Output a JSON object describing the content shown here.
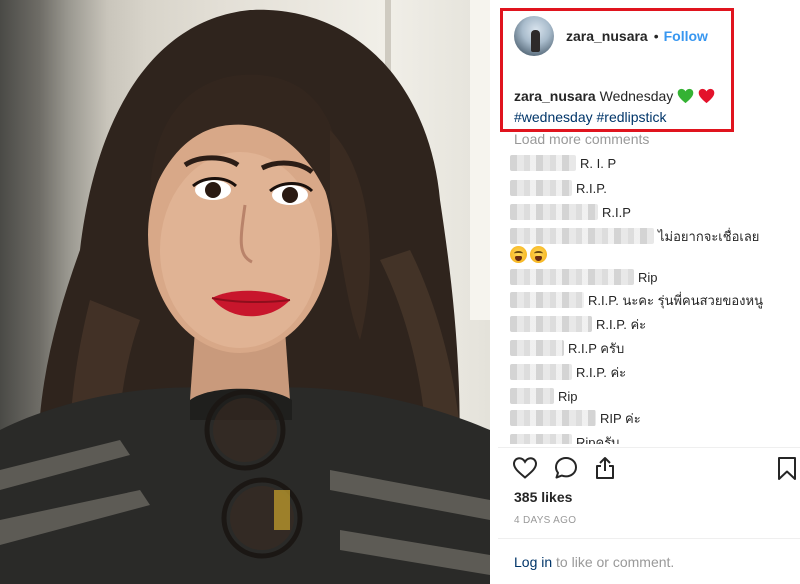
{
  "post": {
    "image_description": "",
    "author": {
      "username": "zara_nusara",
      "separator": "•",
      "follow_label": "Follow"
    },
    "caption": {
      "username": "zara_nusara",
      "text": "Wednesday",
      "emojis": [
        "green-heart",
        "red-heart"
      ],
      "hashtags": "#wednesday #redlipstick"
    },
    "load_more_label": "Load more comments",
    "comments": [
      {
        "text": "R. I. P"
      },
      {
        "text": "R.I.P."
      },
      {
        "text": "R.I.P"
      },
      {
        "text": "ไม่อยากจะเชื่อเลย"
      },
      {
        "text": "Rip"
      },
      {
        "text": "R.I.P. นะคะ รุ่นพี่คนสวยของหนู"
      },
      {
        "text": "R.I.P. ค่ะ"
      },
      {
        "text": "R.I.P ครับ"
      },
      {
        "text": "R.I.P. ค่ะ"
      },
      {
        "text": "Rip"
      },
      {
        "text": "RIP ค่ะ"
      },
      {
        "text": "Ripครับ"
      }
    ],
    "actions": [
      "like-heart-icon",
      "comment-bubble-icon",
      "share-icon",
      "bookmark-icon"
    ],
    "likes_label": "385 likes",
    "timestamp": "4 DAYS AGO",
    "login": {
      "link_label": "Log in",
      "suffix": " to like or comment."
    }
  },
  "colors": {
    "link_blue": "#3897f0",
    "hashtag_navy": "#003569",
    "highlight_red": "#e0141e",
    "muted_gray": "#999999"
  }
}
